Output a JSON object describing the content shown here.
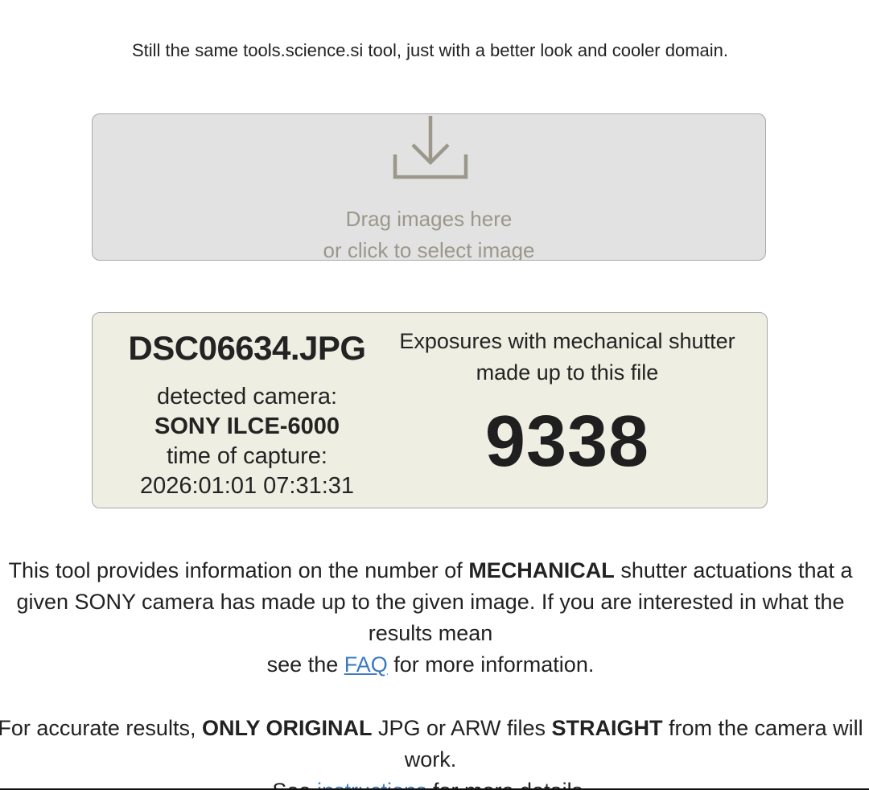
{
  "header": {
    "tagline": "Still the same tools.science.si tool, just with a better look and cooler domain."
  },
  "dropzone": {
    "icon": "download-icon",
    "line1": "Drag images here",
    "line2": "or click to select image"
  },
  "result": {
    "filename": "DSC06634.JPG",
    "camera_label": "detected camera:",
    "camera_value": "SONY ILCE-6000",
    "time_label": "time of capture:",
    "time_value": "2026:01:01 07:31:31",
    "exposure_label_1": "Exposures with mechanical shutter",
    "exposure_label_2": "made up to this file",
    "shutter_count": "9338"
  },
  "info": {
    "p1_a": "This tool provides information on the number of ",
    "p1_bold": "MECHANICAL",
    "p1_b": " shutter actuations that a",
    "p1_c": "given SONY camera has made up to the given image. If you are interested in what the",
    "p1_d": "results mean",
    "p1_e": "see the ",
    "faq_link": "FAQ",
    "p1_f": " for more information.",
    "p2_a": "For accurate results, ",
    "p2_bold1": "ONLY ORIGINAL",
    "p2_b": " JPG or ARW files ",
    "p2_bold2": "STRAIGHT",
    "p2_c": " from the camera will",
    "p2_d": "work.",
    "p2_e": "See ",
    "instructions_link": "instructions",
    "p2_f": " for more details."
  },
  "colors": {
    "dropzone_bg": "#e2e2e2",
    "result_bg": "#eeeee2",
    "muted_text": "#9b978b",
    "link": "#3a7bbf"
  }
}
